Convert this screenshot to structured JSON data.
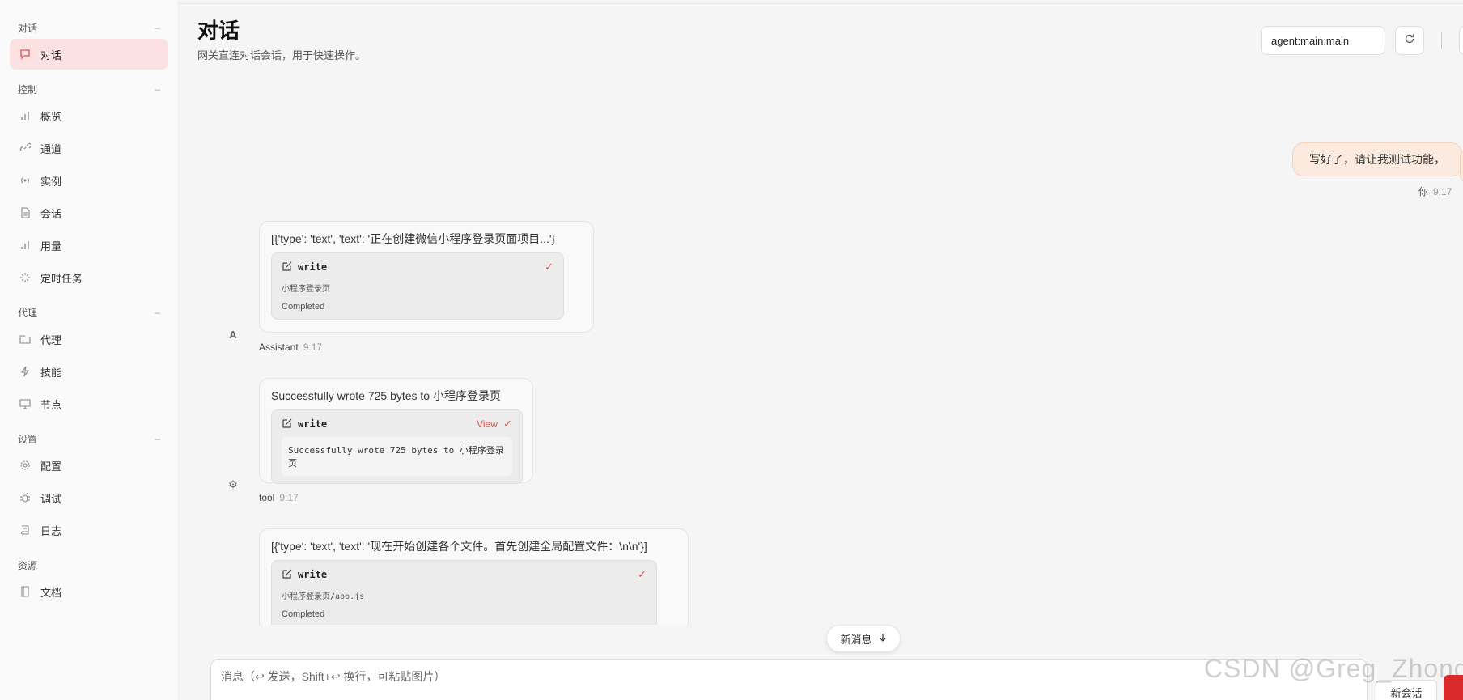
{
  "sidebar": {
    "groups": [
      {
        "title": "对话",
        "items": [
          {
            "label": "对话",
            "icon": "chat-bubble-icon",
            "active": true
          }
        ]
      },
      {
        "title": "控制",
        "items": [
          {
            "label": "概览",
            "icon": "bar-chart-icon"
          },
          {
            "label": "通道",
            "icon": "link-icon"
          },
          {
            "label": "实例",
            "icon": "radio-signal-icon"
          },
          {
            "label": "会话",
            "icon": "document-icon"
          },
          {
            "label": "用量",
            "icon": "bar-chart-icon"
          },
          {
            "label": "定时任务",
            "icon": "spinner-icon"
          }
        ]
      },
      {
        "title": "代理",
        "items": [
          {
            "label": "代理",
            "icon": "folder-icon"
          },
          {
            "label": "技能",
            "icon": "lightning-icon"
          },
          {
            "label": "节点",
            "icon": "monitor-icon"
          }
        ]
      },
      {
        "title": "设置",
        "items": [
          {
            "label": "配置",
            "icon": "gear-icon"
          },
          {
            "label": "调试",
            "icon": "bug-icon"
          },
          {
            "label": "日志",
            "icon": "scroll-icon"
          }
        ]
      },
      {
        "title": "资源",
        "items": [
          {
            "label": "文档",
            "icon": "book-icon"
          }
        ]
      }
    ]
  },
  "header": {
    "title": "对话",
    "subtitle": "网关直连对话会话，用于快速操作。",
    "session_key": "agent:main:main"
  },
  "messages": {
    "user": {
      "text": "写好了，请让我测试功能，",
      "sender": "你",
      "time": "9:17"
    },
    "assistant1": {
      "text": "[{'type': 'text', 'text': '正在创建微信小程序登录页面项目...'}",
      "tool_name": "write",
      "tool_arg": "小程序登录页",
      "status": "Completed",
      "sender": "Assistant",
      "avatar": "A",
      "time": "9:17"
    },
    "tool": {
      "text": "Successfully wrote 725 bytes to 小程序登录页",
      "tool_name": "write",
      "view_label": "View",
      "output": "Successfully wrote 725 bytes to 小程序登录页",
      "sender": "tool",
      "time": "9:17"
    },
    "assistant2": {
      "text": "[{'type': 'text', 'text': '现在开始创建各个文件。首先创建全局配置文件：\\n\\n'}]",
      "tool_name": "write",
      "tool_arg": "小程序登录页/app.js",
      "status": "Completed"
    }
  },
  "new_message_label": "新消息",
  "composer": {
    "placeholder": "消息（↩ 发送，Shift+↩ 换行，可粘贴图片）",
    "new_session_label": "新会话"
  },
  "watermark": "CSDN @Greg_Zhong",
  "colors": {
    "accent": "#d9534f",
    "active_nav_bg": "#fbe1e1",
    "user_bubble_bg": "#fbeadd"
  }
}
